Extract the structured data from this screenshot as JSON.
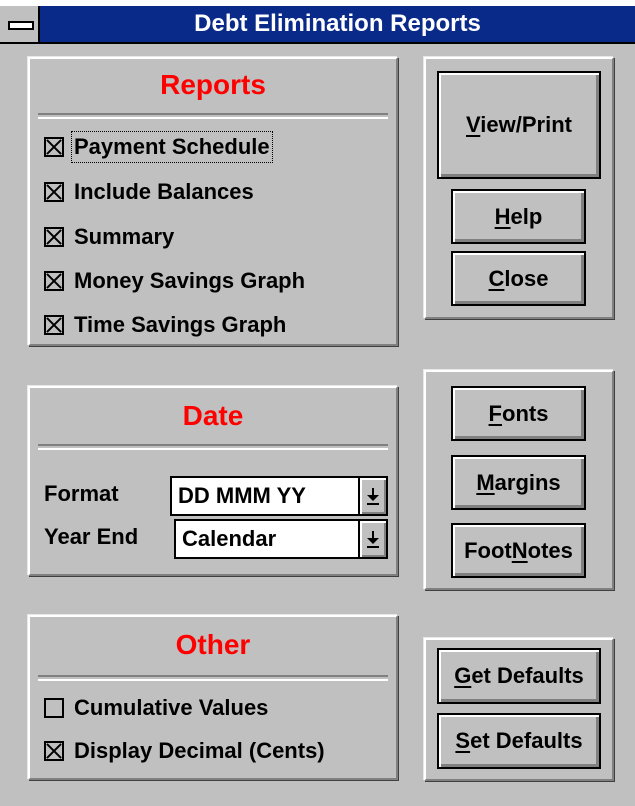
{
  "window": {
    "title": "Debt Elimination Reports"
  },
  "reports": {
    "title": "Reports",
    "items": [
      {
        "label": "Payment Schedule",
        "checked": true
      },
      {
        "label": "Include Balances",
        "checked": true
      },
      {
        "label": "Summary",
        "checked": true
      },
      {
        "label": "Money Savings Graph",
        "checked": true
      },
      {
        "label": "Time Savings Graph",
        "checked": true
      }
    ]
  },
  "date": {
    "title": "Date",
    "format_label": "Format",
    "format_value": "DD MMM YY",
    "year_end_label": "Year End",
    "year_end_value": "Calendar"
  },
  "other": {
    "title": "Other",
    "items": [
      {
        "label": "Cumulative Values",
        "checked": false
      },
      {
        "label": "Display Decimal (Cents)",
        "checked": true
      }
    ]
  },
  "buttons": {
    "view_print": {
      "mnemonic": "V",
      "rest": "iew/Print"
    },
    "help": {
      "mnemonic": "H",
      "rest": "elp"
    },
    "close": {
      "mnemonic": "C",
      "rest": "lose"
    },
    "fonts": {
      "mnemonic": "F",
      "rest": "onts"
    },
    "margins": {
      "mnemonic": "M",
      "rest": "argins"
    },
    "footnotes": {
      "pre": "Foot",
      "mnemonic": "N",
      "rest": "otes"
    },
    "get_defaults": {
      "mnemonic": "G",
      "rest": "et Defaults"
    },
    "set_defaults": {
      "mnemonic": "S",
      "rest": "et Defaults"
    }
  },
  "colors": {
    "title_bar": "#0a2a8a",
    "section_title": "#ff0000",
    "face": "#c0c0c0"
  }
}
